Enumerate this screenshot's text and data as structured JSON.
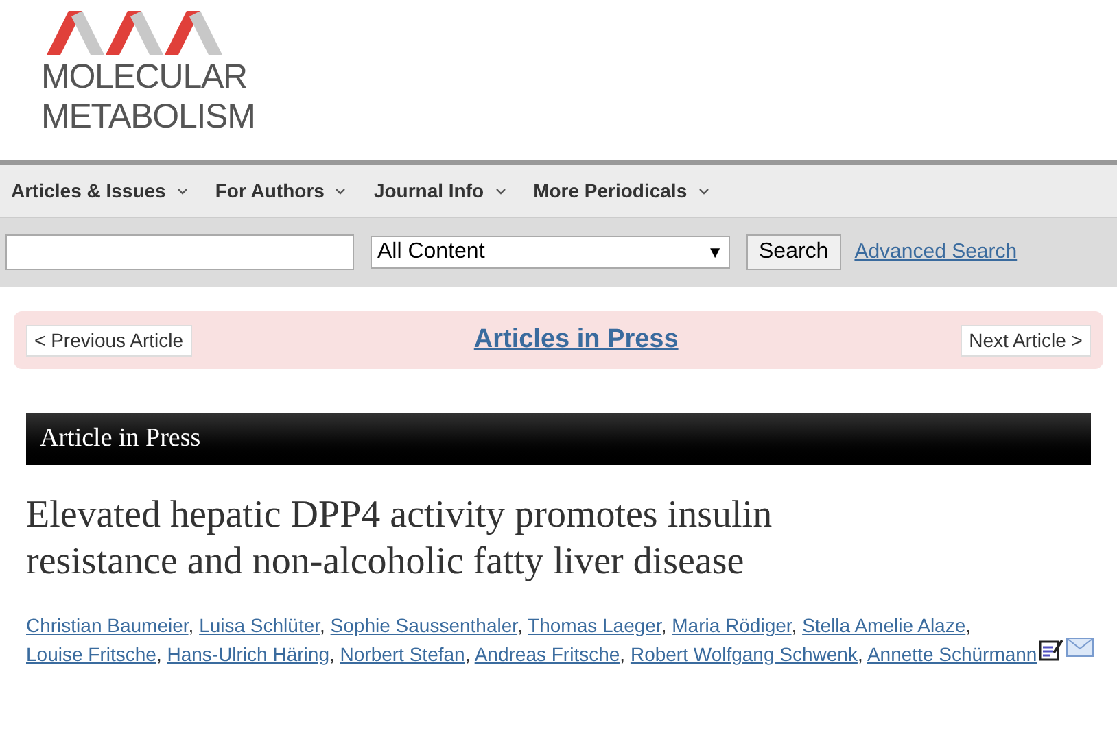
{
  "logo": {
    "lines": [
      "MOLECULAR",
      "METABOLISM"
    ]
  },
  "nav": [
    {
      "label": "Articles & Issues"
    },
    {
      "label": "For Authors"
    },
    {
      "label": "Journal Info"
    },
    {
      "label": "More Periodicals"
    }
  ],
  "search": {
    "scope": "All Content",
    "arrow": "▼",
    "button": "Search",
    "advanced": "Advanced Search"
  },
  "pager": {
    "previous": "< Previous Article",
    "title": "Articles in Press",
    "next": "Next Article >"
  },
  "banner": "Article in Press",
  "article": {
    "title": "Elevated hepatic DPP4 activity promotes insulin resistance and non-alcoholic fatty liver disease",
    "authors": [
      {
        "name": "Christian Baumeier",
        "separator": ","
      },
      {
        "name": "Luisa Schlüter",
        "separator": ","
      },
      {
        "name": "Sophie Saussenthaler",
        "separator": ","
      },
      {
        "name": "Thomas Laeger",
        "separator": ","
      },
      {
        "name": "Maria Rödiger",
        "separator": ","
      },
      {
        "name": "Stella Amelie Alaze",
        "separator": ","
      },
      {
        "name": "Louise Fritsche",
        "separator": ","
      },
      {
        "name": "Hans-Ulrich Häring",
        "separator": ","
      },
      {
        "name": "Norbert Stefan",
        "separator": ","
      },
      {
        "name": "Andreas Fritsche",
        "separator": ","
      },
      {
        "name": "Robert Wolfgang Schwenk",
        "separator": ","
      },
      {
        "name": "Annette Schürmann"
      }
    ]
  }
}
